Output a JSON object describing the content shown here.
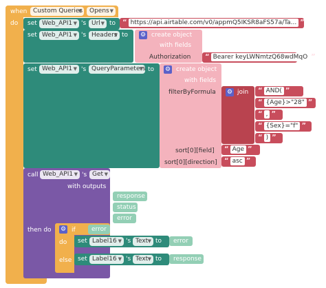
{
  "event": {
    "when": "when",
    "component": "Custom Queries",
    "event_name": "Opens",
    "do": "do"
  },
  "set1": {
    "set": "set",
    "component": "Web_API1",
    "sep": "'s",
    "prop": "Url",
    "to": "to",
    "value": "https://api.airtable.com/v0/appmQ5IKSR8aFS57a/Ta..."
  },
  "set2": {
    "set": "set",
    "component": "Web_API1",
    "sep": "'s",
    "prop": "Headers",
    "to": "to",
    "create": "create object",
    "with_fields": "with fields",
    "field_key": "Authorization",
    "field_value": "Bearer keyLWNmtzQ68wdMqO"
  },
  "set3": {
    "set": "set",
    "component": "Web_API1",
    "sep": "'s",
    "prop": "QueryParameters",
    "to": "to",
    "create": "create object",
    "with_fields": "with fields",
    "filter_key": "filterByFormula",
    "join": "join",
    "join_items": [
      "AND(",
      "{Age}>\"28\"",
      ",",
      "{Sex}=\"f\"",
      ")"
    ],
    "sort_field_key": "sort[0][field]",
    "sort_field_value": "Age",
    "sort_dir_key": "sort[0][direction]",
    "sort_dir_value": "asc"
  },
  "call": {
    "call": "call",
    "component": "Web_API1",
    "sep": "'s",
    "method": "Get",
    "with_outputs": "with outputs",
    "outputs": [
      "response",
      "status",
      "error"
    ],
    "then_do": "then do"
  },
  "ifblock": {
    "if": "if",
    "cond": "error",
    "do": "do",
    "else": "else",
    "set_do": {
      "set": "set",
      "component": "Label16",
      "sep": "'s",
      "prop": "Text",
      "to": "to",
      "value": "error"
    },
    "set_else": {
      "set": "set",
      "component": "Label16",
      "sep": "'s",
      "prop": "Text",
      "to": "to",
      "value": "response"
    }
  },
  "colors": {
    "event": "#f1b04c",
    "set": "#2e8b7a",
    "dict": "#f4b3bd",
    "text": "#c84d5c",
    "call": "#7a58a6",
    "var": "#93cfb5"
  }
}
